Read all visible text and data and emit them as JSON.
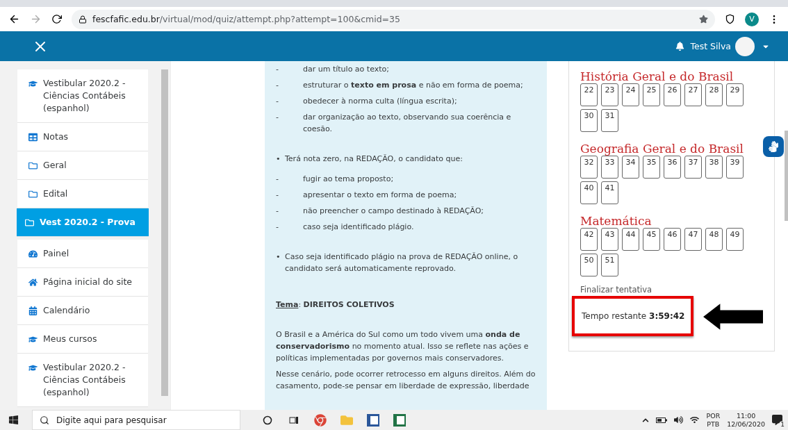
{
  "browser": {
    "url_host": "fescfafic.edu.br",
    "url_path": "/virtual/mod/quiz/attempt.php?attempt=100&cmid=35",
    "profile_initial": "V"
  },
  "header": {
    "user_name": "Test Silva"
  },
  "sidebar": {
    "items": [
      {
        "label": "Vestibular 2020.2 - Ciências Contábeis (espanhol)",
        "kind": "course",
        "selected": false
      },
      {
        "label": "Notas",
        "kind": "grades",
        "selected": false
      },
      {
        "label": "Geral",
        "kind": "folder",
        "selected": false
      },
      {
        "label": "Edital",
        "kind": "folder",
        "selected": false
      },
      {
        "label": "Vest 2020.2 - Prova",
        "kind": "folder",
        "selected": true
      },
      {
        "label": "Painel",
        "kind": "dashboard",
        "selected": false
      },
      {
        "label": "Página inicial do site",
        "kind": "home",
        "selected": false
      },
      {
        "label": "Calendário",
        "kind": "calendar",
        "selected": false
      },
      {
        "label": "Meus cursos",
        "kind": "course",
        "selected": false
      },
      {
        "label": "Vestibular 2020.2 - Ciências Contábeis (espanhol)",
        "kind": "course",
        "selected": false
      }
    ]
  },
  "content": [
    {
      "kind": "dash",
      "marker": "-",
      "text": "dar um título ao texto;"
    },
    {
      "kind": "dash",
      "marker": "-",
      "text": "estruturar o **texto em prosa** e não em forma de poema;"
    },
    {
      "kind": "dash",
      "marker": "-",
      "text": "obedecer à norma culta (língua escrita);"
    },
    {
      "kind": "dash",
      "marker": "-",
      "text": "dar organização ao texto, observando sua coerência e coesão."
    },
    {
      "kind": "bullet",
      "marker": "•",
      "text": "Terá nota zero, na REDAÇÃO, o candidato que:"
    },
    {
      "kind": "dash",
      "marker": "-",
      "text": "fugir ao tema proposto;"
    },
    {
      "kind": "dash",
      "marker": "-",
      "text": "apresentar o texto em forma de poema;"
    },
    {
      "kind": "dash",
      "marker": "-",
      "text": "não preencher o campo destinado à REDAÇÃO;"
    },
    {
      "kind": "dash",
      "marker": "-",
      "text": "caso seja identificado plágio."
    },
    {
      "kind": "bullet",
      "marker": "•",
      "text": "Caso seja identificado plágio na prova de REDAÇÃO online, o candidato será automaticamente reprovado."
    },
    {
      "kind": "heading",
      "label": "Tema",
      "text": ": **DIREITOS COLETIVOS**"
    },
    {
      "kind": "paragraph",
      "text": "O Brasil e a América do Sul como um todo vivem uma **onda de conservadorismo** no momento atual. Isso se reflete nas ações e políticas implementadas por governos mais conservadores."
    },
    {
      "kind": "paragraph",
      "text": "Nesse cenário, pode ocorrer retrocesso em alguns direitos. Além do casamento, pode-se pensar em liberdade de expressão, liberdade"
    }
  ],
  "quiz_nav": {
    "sections": [
      {
        "title": "História Geral e do Brasil",
        "questions": [
          "22",
          "23",
          "24",
          "25",
          "26",
          "27",
          "28",
          "29",
          "30",
          "31"
        ]
      },
      {
        "title": "Geografia Geral e do Brasil",
        "questions": [
          "32",
          "33",
          "34",
          "35",
          "36",
          "37",
          "38",
          "39",
          "40",
          "41"
        ]
      },
      {
        "title": "Matemática",
        "questions": [
          "42",
          "43",
          "44",
          "45",
          "46",
          "47",
          "48",
          "49",
          "50",
          "51"
        ]
      }
    ],
    "finish_link": "Finalizar tentativa",
    "timer_label": "Tempo restante",
    "timer_value": "3:59:42"
  },
  "taskbar": {
    "search_placeholder": "Digite aqui para pesquisar",
    "language": "POR",
    "layout": "PTB",
    "time": "11:00",
    "date": "12/06/2020",
    "notifications": "1"
  }
}
